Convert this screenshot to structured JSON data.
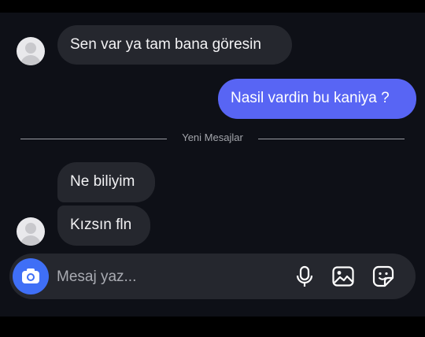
{
  "messages": [
    {
      "direction": "incoming",
      "text": "Sen var ya tam bana göresin"
    },
    {
      "direction": "outgoing",
      "text": "Nasil vardin bu kaniya ?"
    },
    {
      "direction": "incoming",
      "text": "Ne biliyim"
    },
    {
      "direction": "incoming",
      "text": "Kızsın fln"
    }
  ],
  "divider": {
    "label": "Yeni Mesajlar"
  },
  "composer": {
    "placeholder": "Mesaj yaz...",
    "icons": [
      "camera-icon",
      "microphone-icon",
      "image-icon",
      "sticker-icon"
    ]
  },
  "colors": {
    "background": "#0e1017",
    "incoming_bubble": "#25272e",
    "outgoing_bubble": "#5865f4",
    "camera_button": "#3f6ff6"
  }
}
